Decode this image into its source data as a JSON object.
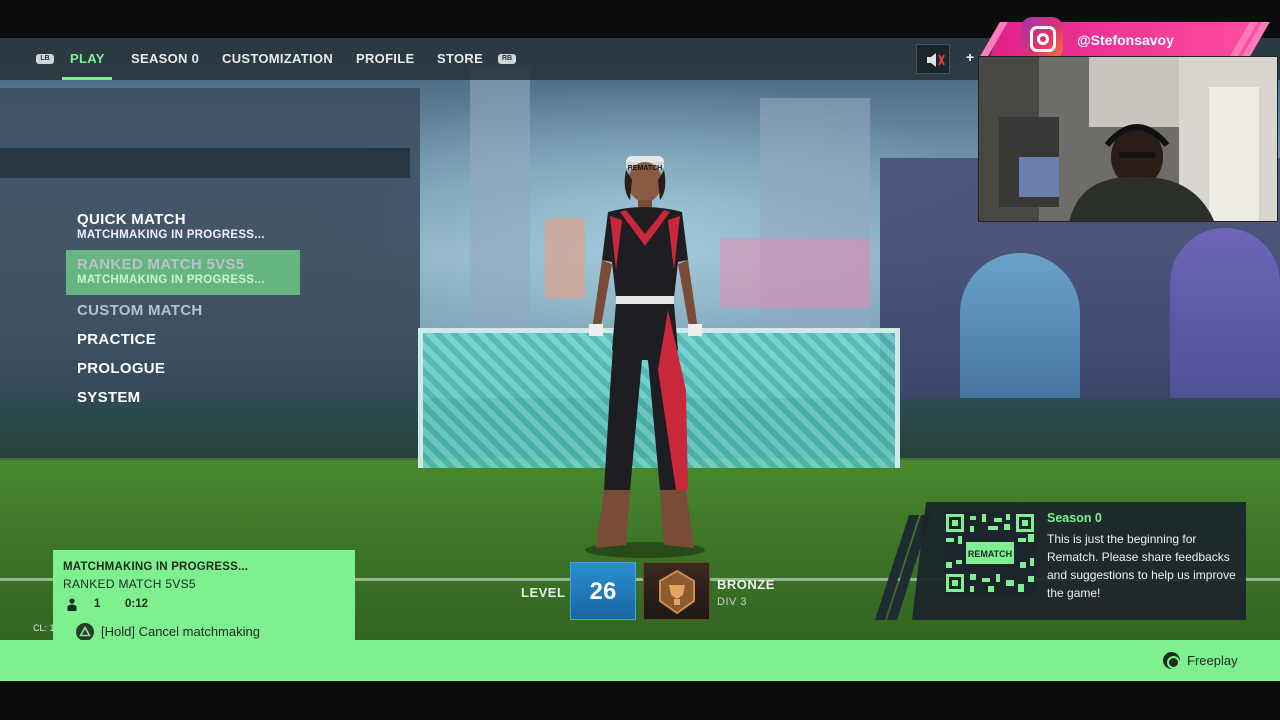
{
  "nav": {
    "left_bumper": "LB",
    "right_bumper": "RB",
    "tabs": [
      {
        "label": "PLAY",
        "active": true
      },
      {
        "label": "SEASON 0",
        "active": false
      },
      {
        "label": "CUSTOMIZATION",
        "active": false
      },
      {
        "label": "PROFILE",
        "active": false
      },
      {
        "label": "STORE",
        "active": false
      }
    ],
    "plus_label": "+"
  },
  "menu": [
    {
      "title": "QUICK MATCH",
      "subtitle": "MATCHMAKING IN PROGRESS..."
    },
    {
      "title": "RANKED MATCH 5VS5",
      "subtitle": "MATCHMAKING IN PROGRESS...",
      "selected": true
    },
    {
      "title": "CUSTOM MATCH",
      "disabled": true
    },
    {
      "title": "PRACTICE"
    },
    {
      "title": "PROLOGUE"
    },
    {
      "title": "SYSTEM"
    }
  ],
  "player": {
    "level_label": "LEVEL",
    "level": "26",
    "rank": "BRONZE",
    "division": "DIV 3"
  },
  "matchmaking": {
    "status": "MATCHMAKING IN PROGRESS...",
    "mode": "RANKED MATCH 5VS5",
    "party_count": "1",
    "elapsed": "0:12",
    "cancel_label": "[Hold] Cancel matchmaking",
    "cl_label": "CL: 1"
  },
  "season_card": {
    "title": "Season 0",
    "body": "This is just the beginning for Rematch. Please share feedbacks and suggestions to help us improve the game!",
    "qr_caption": "REMATCH"
  },
  "bottom_bar": {
    "freeplay_label": "Freeplay"
  },
  "stream_overlay": {
    "instagram_handle": "@Stefonsavoy"
  },
  "colors": {
    "accent_green": "#7ef08f",
    "nav_bg": "#28343a",
    "level_blue": "#1f7cc0",
    "instagram_pink": "#e0208a"
  },
  "icons": {
    "mute": "speaker-muted-icon",
    "instagram": "instagram-icon",
    "party": "person-icon",
    "cancel": "triangle-button-icon",
    "freeplay": "circle-button-icon",
    "rank": "bronze-rank-emblem-icon"
  }
}
